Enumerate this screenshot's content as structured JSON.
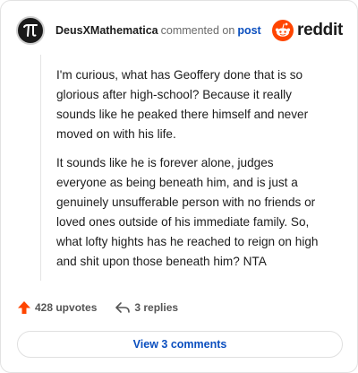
{
  "header": {
    "username": "DeusXMathematica",
    "commented_on": "commented on",
    "post_link": "post",
    "brand_name": "reddit",
    "avatar_icon": "pi-symbol-avatar",
    "brand_icon": "reddit-snoo-icon"
  },
  "comment": {
    "paragraphs": [
      "I'm curious, what has Geoffery done that is so glorious after high-school? Because it really sounds like he peaked there himself and never moved on with his life.",
      "It sounds like he is forever alone, judges everyone as being beneath him, and is just a genuinely unsufferable person with no friends or loved ones outside of his immediate family. So, what lofty hights has he reached to reign on high and shit upon those beneath him? NTA"
    ]
  },
  "actions": {
    "upvotes": "428 upvotes",
    "replies": "3 replies"
  },
  "view_comments": "View 3 comments",
  "colors": {
    "accent": "#ff4500",
    "link": "#0b4fbf",
    "text": "#1c1c1c",
    "muted": "#555555"
  }
}
